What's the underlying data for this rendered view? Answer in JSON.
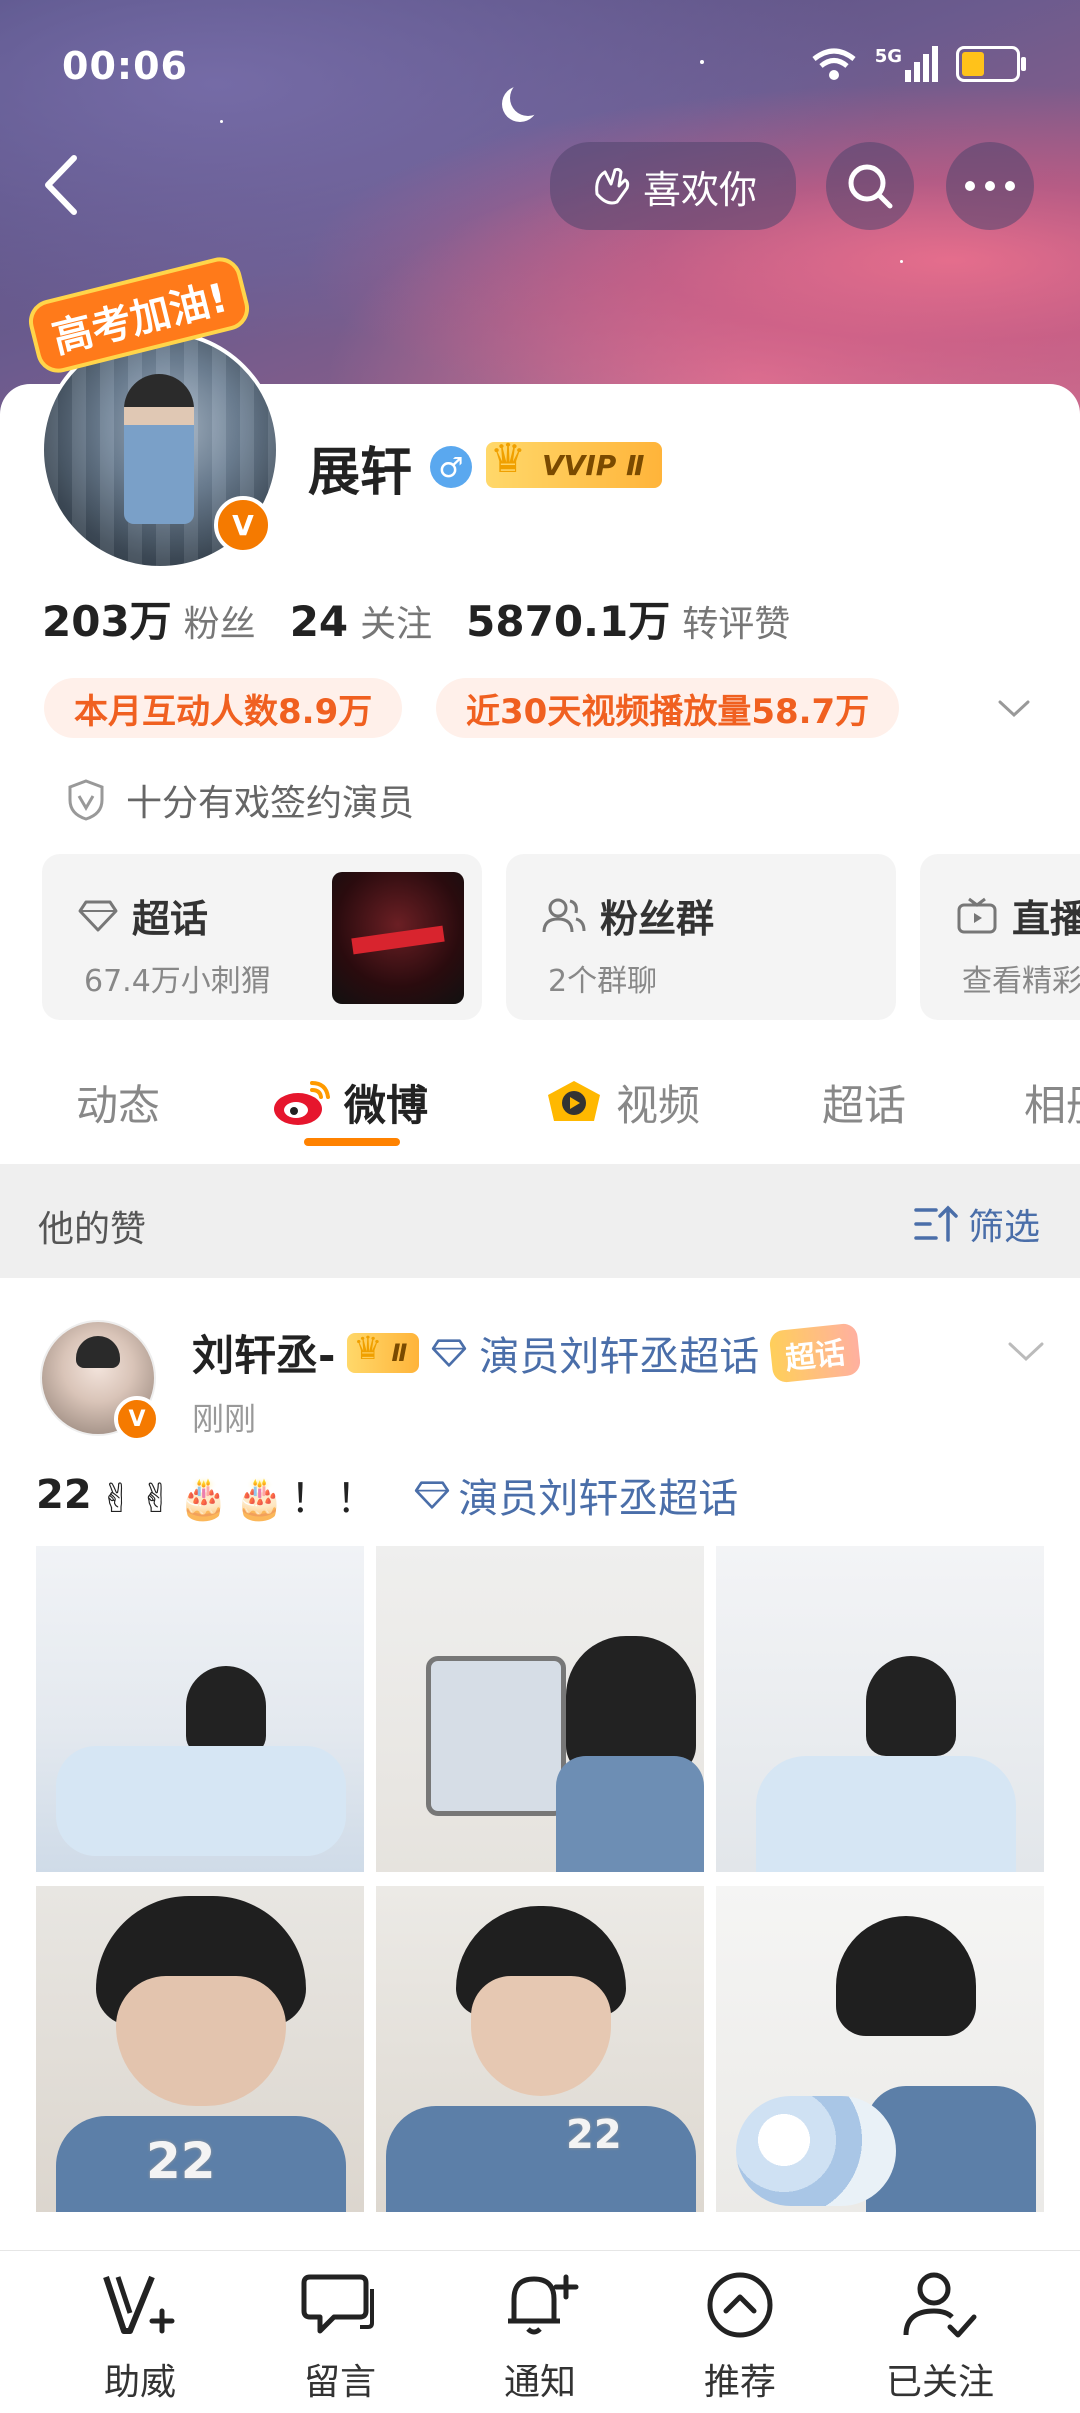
{
  "status_bar": {
    "time": "00:06",
    "network": "5G"
  },
  "header": {
    "like_button_label": "喜欢你"
  },
  "profile": {
    "sticker_text": "高考加油!",
    "name": "展轩",
    "gender_symbol": "♂",
    "vip_badge": "VVIP Ⅱ",
    "verified_mark": "V",
    "stats": [
      {
        "value": "203万",
        "label": "粉丝"
      },
      {
        "value": "24",
        "label": "关注"
      },
      {
        "value": "5870.1万",
        "label": "转评赞"
      }
    ],
    "chips": [
      "本月互动人数8.9万",
      "近30天视频播放量58.7万"
    ],
    "verification": "十分有戏签约演员"
  },
  "tiles": [
    {
      "title": "超话",
      "subtitle": "67.4万小刺猬"
    },
    {
      "title": "粉丝群",
      "subtitle": "2个群聊"
    },
    {
      "title": "直播",
      "subtitle": "查看精彩"
    }
  ],
  "tabs": [
    {
      "label": "动态",
      "active": false
    },
    {
      "label": "微博",
      "active": true
    },
    {
      "label": "视频",
      "active": false
    },
    {
      "label": "超话",
      "active": false
    },
    {
      "label": "相册",
      "active": false
    }
  ],
  "section": {
    "title": "他的赞",
    "filter_label": "筛选"
  },
  "post": {
    "author": "刘轩丞-",
    "author_badge": "Ⅱ",
    "topic": "演员刘轩丞超话",
    "topic_tag": "超话",
    "time": "刚刚",
    "text_prefix": "22",
    "text_emoji": "✌✌🎂🎂！！",
    "text_topic": "演员刘轩丞超话",
    "photo_digit_labels": [
      "22",
      "22"
    ]
  },
  "bottom_nav": [
    {
      "label": "助威",
      "icon": "v-plus-icon"
    },
    {
      "label": "留言",
      "icon": "message-icon"
    },
    {
      "label": "通知",
      "icon": "bell-plus-icon"
    },
    {
      "label": "推荐",
      "icon": "chevron-up-circle-icon"
    },
    {
      "label": "已关注",
      "icon": "user-check-icon"
    }
  ],
  "colors": {
    "accent": "#ff8200",
    "topic_blue": "#4a6ea9",
    "chip_bg": "#fff0ea",
    "chip_text": "#f06020"
  }
}
